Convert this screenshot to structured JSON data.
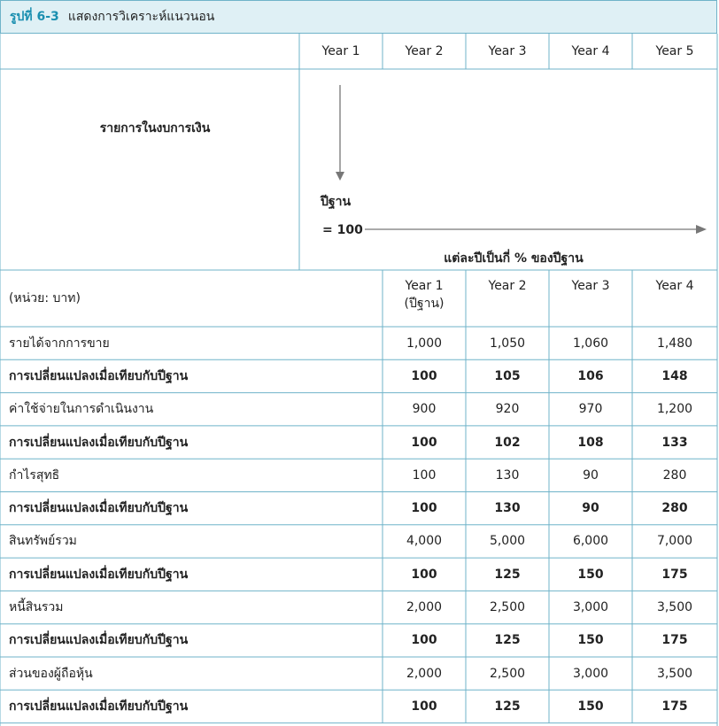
{
  "figure": {
    "number": "รูปที่ 6-3",
    "caption": "แสดงการวิเคราะห์แนวนอน"
  },
  "top_header": {
    "years": [
      "Year 1",
      "Year 2",
      "Year 3",
      "Year 4",
      "Year 5"
    ]
  },
  "concept": {
    "row_label": "รายการในงบการเงิน",
    "base_year_label": "ปีฐาน",
    "base_value_label": "= 100",
    "percent_label": "แต่ละปีเป็นกี่ % ของปีฐาน"
  },
  "table": {
    "unit_label": "(หน่วย: บาท)",
    "columns": [
      {
        "line1": "Year 1",
        "line2": "(ปีฐาน)"
      },
      {
        "line1": "Year 2",
        "line2": ""
      },
      {
        "line1": "Year 3",
        "line2": ""
      },
      {
        "line1": "Year 4",
        "line2": ""
      }
    ],
    "rows": [
      {
        "label": "รายได้จากการขาย",
        "values": [
          "1,000",
          "1,050",
          "1,060",
          "1,480"
        ],
        "bold": false
      },
      {
        "label": "การเปลี่ยนแปลงเมื่อเทียบกับปีฐาน",
        "values": [
          "100",
          "105",
          "106",
          "148"
        ],
        "bold": true
      },
      {
        "label": "ค่าใช้จ่ายในการดำเนินงาน",
        "values": [
          "900",
          "920",
          "970",
          "1,200"
        ],
        "bold": false
      },
      {
        "label": "การเปลี่ยนแปลงเมื่อเทียบกับปีฐาน",
        "values": [
          "100",
          "102",
          "108",
          "133"
        ],
        "bold": true
      },
      {
        "label": "กำไรสุทธิ",
        "values": [
          "100",
          "130",
          "90",
          "280"
        ],
        "bold": false
      },
      {
        "label": "การเปลี่ยนแปลงเมื่อเทียบกับปีฐาน",
        "values": [
          "100",
          "130",
          "90",
          "280"
        ],
        "bold": true
      },
      {
        "label": "สินทรัพย์รวม",
        "values": [
          "4,000",
          "5,000",
          "6,000",
          "7,000"
        ],
        "bold": false
      },
      {
        "label": "การเปลี่ยนแปลงเมื่อเทียบกับปีฐาน",
        "values": [
          "100",
          "125",
          "150",
          "175"
        ],
        "bold": true
      },
      {
        "label": "หนี้สินรวม",
        "values": [
          "2,000",
          "2,500",
          "3,000",
          "3,500"
        ],
        "bold": false
      },
      {
        "label": "การเปลี่ยนแปลงเมื่อเทียบกับปีฐาน",
        "values": [
          "100",
          "125",
          "150",
          "175"
        ],
        "bold": true
      },
      {
        "label": "ส่วนของผู้ถือหุ้น",
        "values": [
          "2,000",
          "2,500",
          "3,000",
          "3,500"
        ],
        "bold": false
      },
      {
        "label": "การเปลี่ยนแปลงเมื่อเทียบกับปีฐาน",
        "values": [
          "100",
          "125",
          "150",
          "175"
        ],
        "bold": true
      }
    ]
  },
  "colors": {
    "border": "#6fb3c9",
    "header_fill": "#dff0f5",
    "figure_number": "#1a8fb0",
    "arrow": "#777777"
  }
}
